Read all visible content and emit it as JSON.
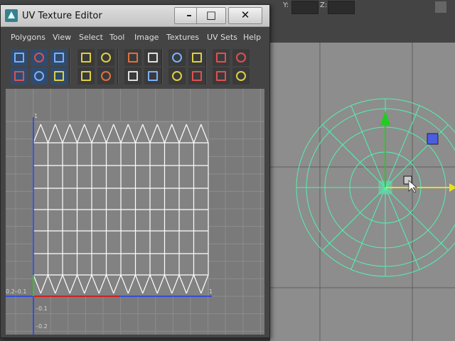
{
  "topbar": {
    "y_label": "Y:",
    "z_label": "Z:"
  },
  "window": {
    "title": "UV Texture Editor"
  },
  "menu": [
    "Polygons",
    "View",
    "Select",
    "Tool",
    "Image",
    "Textures",
    "UV Sets",
    "Help"
  ],
  "toolbar_icons": [
    "select-uv-icon",
    "move-uv-icon",
    "scale-uv-icon",
    "flip-h-icon",
    "flip-v-icon",
    "cut-uv-icon",
    "sew-uv-icon",
    "align-uv-icon",
    "grid-uv-icon",
    "stack-icon",
    "layout-icon",
    "straighten-icon",
    "snap-icon",
    "rotate-ccw-icon",
    "rotate-cw-icon",
    "unfold-icon",
    "relax-icon",
    "shell-icon",
    "pin-icon",
    "checker-icon",
    "move-down-icon",
    "distribute-icon"
  ],
  "uv_labels": {
    "top": "1",
    "origin": "0.2–0.1",
    "right": "1",
    "neg01": "–0.1",
    "neg02": "–0.2"
  },
  "colors": {
    "mesh": "#55f0b0",
    "uv_wire": "#ffffff",
    "axis_blue": "#1a3cff",
    "axis_red": "#d02020",
    "axis_green": "#22cc22"
  }
}
